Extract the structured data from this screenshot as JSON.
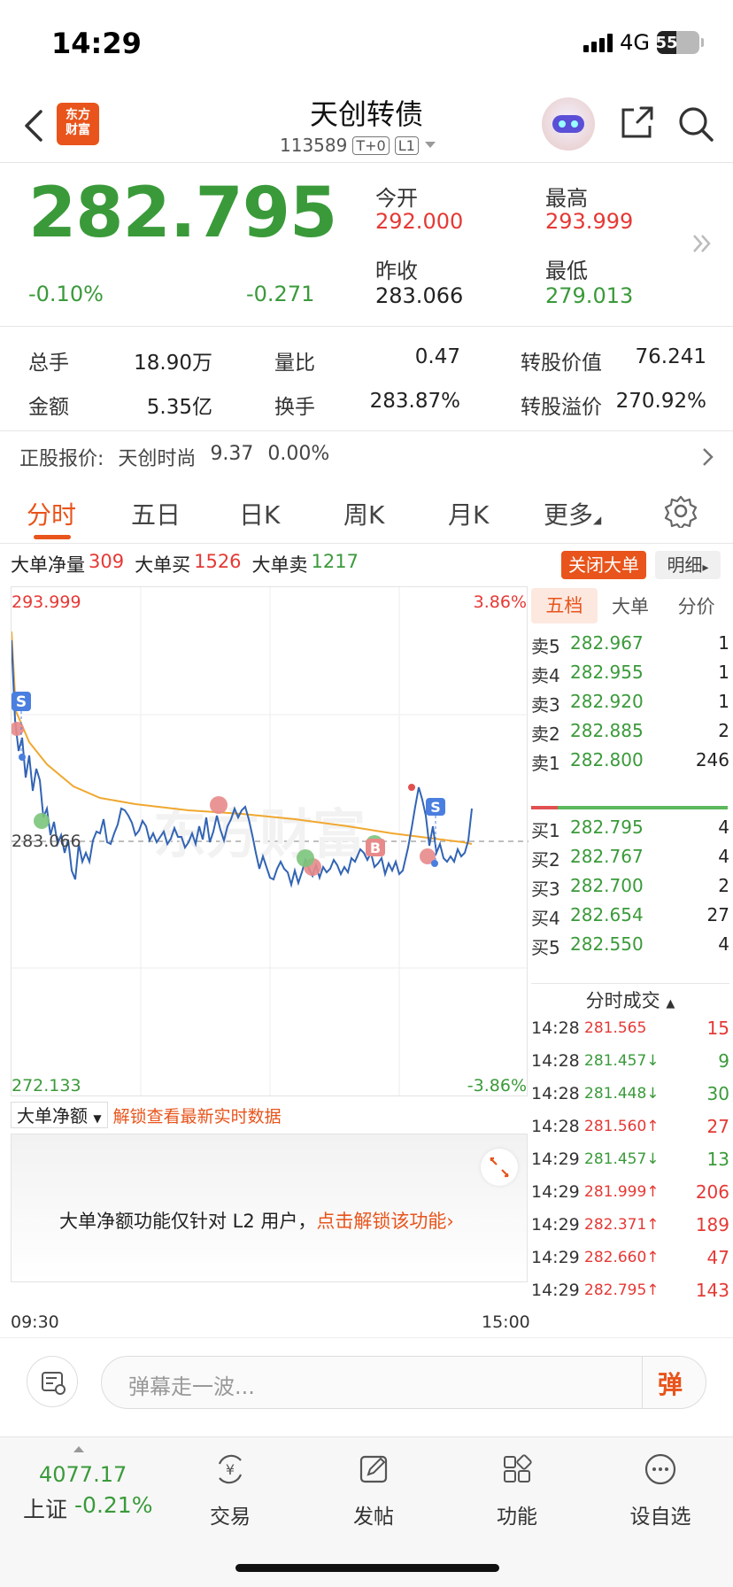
{
  "status": {
    "time": "14:29",
    "network": "4G",
    "battery": "55"
  },
  "header": {
    "logo_text_1": "东方",
    "logo_text_2": "财富",
    "title": "天创转债",
    "code": "113589",
    "tag1": "T+0",
    "tag2": "L1"
  },
  "quote": {
    "price": "282.795",
    "change_pct": "-0.10%",
    "change": "-0.271",
    "open_label": "今开",
    "open": "292.000",
    "high_label": "最高",
    "high": "293.999",
    "prev_close_label": "昨收",
    "prev_close": "283.066",
    "low_label": "最低",
    "low": "279.013"
  },
  "stats": [
    {
      "label": "总手",
      "value": "18.90万"
    },
    {
      "label": "量比",
      "value": "0.47"
    },
    {
      "label": "转股价值",
      "value": "76.241"
    },
    {
      "label": "金额",
      "value": "5.35亿"
    },
    {
      "label": "换手",
      "value": "283.87%"
    },
    {
      "label": "转股溢价",
      "value": "270.92%"
    }
  ],
  "stock": {
    "label": "正股报价:",
    "name": "天创时尚",
    "price": "9.37",
    "pct": "0.00%"
  },
  "tabs": [
    "分时",
    "五日",
    "日K",
    "周K",
    "月K",
    "更多"
  ],
  "bigorder": {
    "net_label": "大单净量",
    "net": "309",
    "buy_label": "大单买",
    "buy": "1526",
    "sell_label": "大单卖",
    "sell": "1217",
    "close_btn": "关闭大单",
    "detail_btn": "明细"
  },
  "chart_data": {
    "type": "line",
    "y_top": "293.999",
    "y_bottom": "272.133",
    "y_mid": "283.066",
    "pct_top": "3.86%",
    "pct_bottom": "-3.86%",
    "x_start": "09:30",
    "x_end": "15:00",
    "net_amount_label": "大单净额",
    "unlock_link": "解锁查看最新实时数据",
    "l2_notice": "大单净额功能仅针对 L2 用户，",
    "l2_link": "点击解锁该功能",
    "watermark": "东方财富"
  },
  "orderbook": {
    "tabs": [
      "五档",
      "大单",
      "分价"
    ],
    "sells": [
      {
        "label": "卖5",
        "price": "282.967",
        "vol": "1"
      },
      {
        "label": "卖4",
        "price": "282.955",
        "vol": "1"
      },
      {
        "label": "卖3",
        "price": "282.920",
        "vol": "1"
      },
      {
        "label": "卖2",
        "price": "282.885",
        "vol": "2"
      },
      {
        "label": "卖1",
        "price": "282.800",
        "vol": "246"
      }
    ],
    "buys": [
      {
        "label": "买1",
        "price": "282.795",
        "vol": "4"
      },
      {
        "label": "买2",
        "price": "282.767",
        "vol": "4"
      },
      {
        "label": "买3",
        "price": "282.700",
        "vol": "2"
      },
      {
        "label": "买4",
        "price": "282.654",
        "vol": "27"
      },
      {
        "label": "买5",
        "price": "282.550",
        "vol": "4"
      }
    ],
    "trades_title": "分时成交",
    "trades": [
      {
        "time": "14:28",
        "price": "281.565",
        "arrow": "",
        "vol": "15",
        "color": "red"
      },
      {
        "time": "14:28",
        "price": "281.457↓",
        "arrow": "",
        "vol": "9",
        "color": "green"
      },
      {
        "time": "14:28",
        "price": "281.448↓",
        "arrow": "",
        "vol": "30",
        "color": "green"
      },
      {
        "time": "14:28",
        "price": "281.560↑",
        "arrow": "",
        "vol": "27",
        "color": "red"
      },
      {
        "time": "14:29",
        "price": "281.457↓",
        "arrow": "",
        "vol": "13",
        "color": "green"
      },
      {
        "time": "14:29",
        "price": "281.999↑",
        "arrow": "",
        "vol": "206",
        "color": "red"
      },
      {
        "time": "14:29",
        "price": "282.371↑",
        "arrow": "",
        "vol": "189",
        "color": "red"
      },
      {
        "time": "14:29",
        "price": "282.660↑",
        "arrow": "",
        "vol": "47",
        "color": "red"
      },
      {
        "time": "14:29",
        "price": "282.795↑",
        "arrow": "",
        "vol": "143",
        "color": "red"
      }
    ]
  },
  "danmu": {
    "placeholder": "弹幕走一波...",
    "send": "弹"
  },
  "bottom": {
    "index_value": "4077.17",
    "index_name": "上证",
    "index_pct": "-0.21%",
    "items": [
      "交易",
      "发帖",
      "功能",
      "设自选"
    ]
  }
}
